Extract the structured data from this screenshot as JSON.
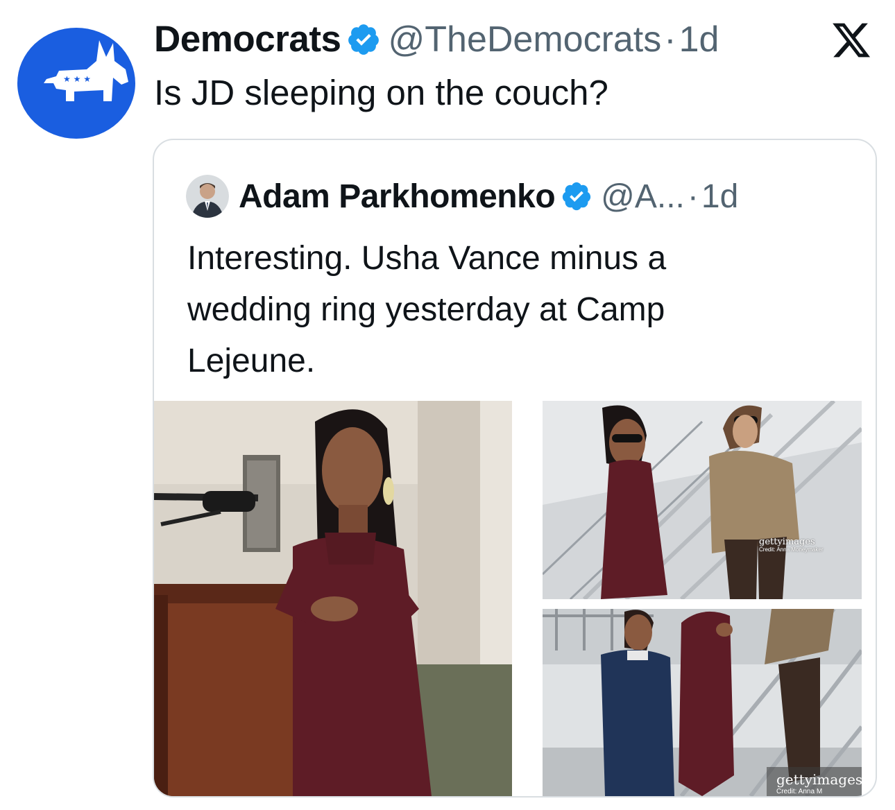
{
  "tweet": {
    "author_name": "Democrats",
    "handle": "@TheDemocrats",
    "separator": "·",
    "time": "1d",
    "text": "Is JD sleeping on the couch?",
    "avatar_icon": "democrats-donkey-logo",
    "brand_color": "#1a5ee0",
    "verified_color": "#1d9bf0"
  },
  "platform": {
    "logo_icon": "x-logo"
  },
  "quote": {
    "author_name": "Adam Parkhomenko",
    "handle": "@A...",
    "separator": "·",
    "time": "1d",
    "text": "Interesting. Usha Vance minus a wedding ring yesterday at Camp Lejeune.",
    "avatar_icon": "profile-avatar",
    "images": [
      {
        "name": "photo-podium"
      },
      {
        "name": "photo-stairs-top",
        "watermark": "gettyimages",
        "credit": "Credit: Anna Moneymaker"
      },
      {
        "name": "photo-stairs-bottom",
        "watermark": "gettyimages",
        "credit": "Credit: Anna M"
      }
    ]
  }
}
